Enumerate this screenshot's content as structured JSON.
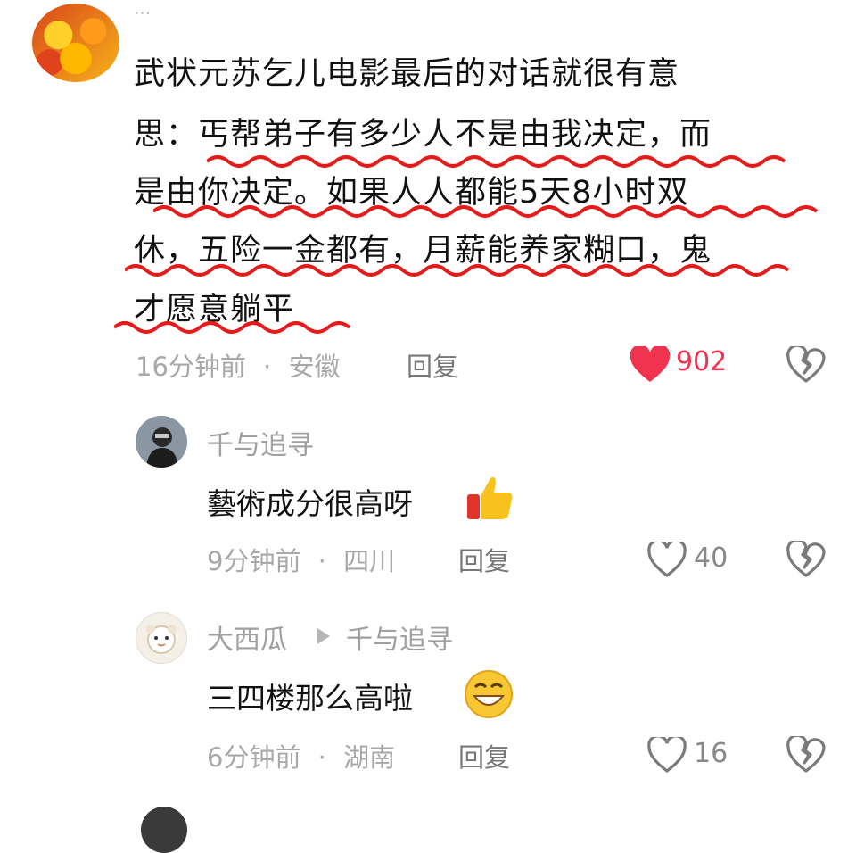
{
  "main_comment": {
    "author_cut": "...",
    "lines": [
      "武状元苏乞儿电影最后的对话就很有意",
      "思：丐帮弟子有多少人不是由我决定，而",
      "是由你决定。如果人人都能5天8小时双",
      "休，五险一金都有，月薪能养家糊口，鬼",
      "才愿意躺平"
    ],
    "time": "16分钟前",
    "separator": "·",
    "location": "安徽",
    "reply_label": "回复",
    "likes": "902",
    "like_color": "#f0334f",
    "underline_color": "#e41b1b"
  },
  "replies": [
    {
      "author": "千与追寻",
      "reply_to": "",
      "text": "藝術成分很高呀",
      "emoji_icon": "thumbs-up-icon",
      "time": "9分钟前",
      "separator": "·",
      "location": "四川",
      "reply_label": "回复",
      "likes": "40"
    },
    {
      "author": "大西瓜",
      "reply_to": "千与追寻",
      "text": "三四楼那么高啦",
      "emoji_icon": "grinning-face-icon",
      "time": "6分钟前",
      "separator": "·",
      "location": "湖南",
      "reply_label": "回复",
      "likes": "16"
    }
  ]
}
